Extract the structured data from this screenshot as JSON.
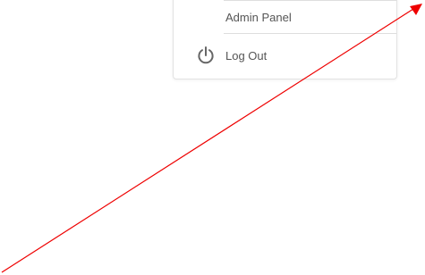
{
  "menu": {
    "items": [
      {
        "label": "Admin Panel"
      },
      {
        "label": "Log Out",
        "icon": "power-icon"
      }
    ]
  },
  "annotation": {
    "arrow_color": "#ee0000"
  }
}
